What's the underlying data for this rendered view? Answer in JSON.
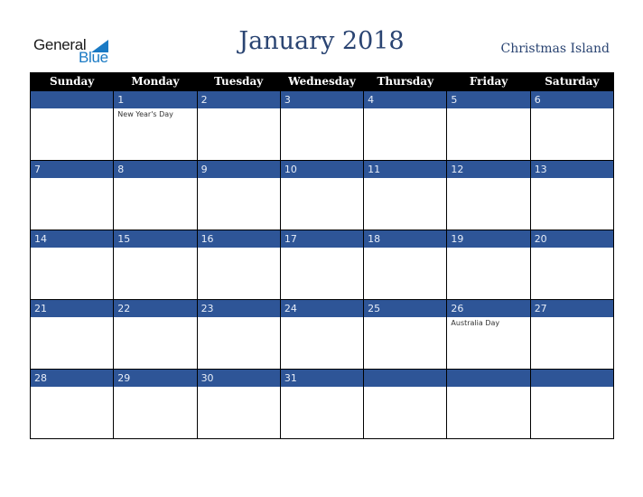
{
  "logo": {
    "line1": "General",
    "line2": "Blue"
  },
  "title": "January 2018",
  "region": "Christmas Island",
  "colors": {
    "header_bg": "#000000",
    "daynum_band": "#2e5597",
    "title_text": "#2a4472",
    "logo_blue": "#1a7ac4"
  },
  "weekdays": [
    "Sunday",
    "Monday",
    "Tuesday",
    "Wednesday",
    "Thursday",
    "Friday",
    "Saturday"
  ],
  "weeks": [
    [
      {
        "day": "",
        "holiday": ""
      },
      {
        "day": "1",
        "holiday": "New Year's Day"
      },
      {
        "day": "2",
        "holiday": ""
      },
      {
        "day": "3",
        "holiday": ""
      },
      {
        "day": "4",
        "holiday": ""
      },
      {
        "day": "5",
        "holiday": ""
      },
      {
        "day": "6",
        "holiday": ""
      }
    ],
    [
      {
        "day": "7",
        "holiday": ""
      },
      {
        "day": "8",
        "holiday": ""
      },
      {
        "day": "9",
        "holiday": ""
      },
      {
        "day": "10",
        "holiday": ""
      },
      {
        "day": "11",
        "holiday": ""
      },
      {
        "day": "12",
        "holiday": ""
      },
      {
        "day": "13",
        "holiday": ""
      }
    ],
    [
      {
        "day": "14",
        "holiday": ""
      },
      {
        "day": "15",
        "holiday": ""
      },
      {
        "day": "16",
        "holiday": ""
      },
      {
        "day": "17",
        "holiday": ""
      },
      {
        "day": "18",
        "holiday": ""
      },
      {
        "day": "19",
        "holiday": ""
      },
      {
        "day": "20",
        "holiday": ""
      }
    ],
    [
      {
        "day": "21",
        "holiday": ""
      },
      {
        "day": "22",
        "holiday": ""
      },
      {
        "day": "23",
        "holiday": ""
      },
      {
        "day": "24",
        "holiday": ""
      },
      {
        "day": "25",
        "holiday": ""
      },
      {
        "day": "26",
        "holiday": "Australia Day"
      },
      {
        "day": "27",
        "holiday": ""
      }
    ],
    [
      {
        "day": "28",
        "holiday": ""
      },
      {
        "day": "29",
        "holiday": ""
      },
      {
        "day": "30",
        "holiday": ""
      },
      {
        "day": "31",
        "holiday": ""
      },
      {
        "day": "",
        "holiday": ""
      },
      {
        "day": "",
        "holiday": ""
      },
      {
        "day": "",
        "holiday": ""
      }
    ]
  ]
}
